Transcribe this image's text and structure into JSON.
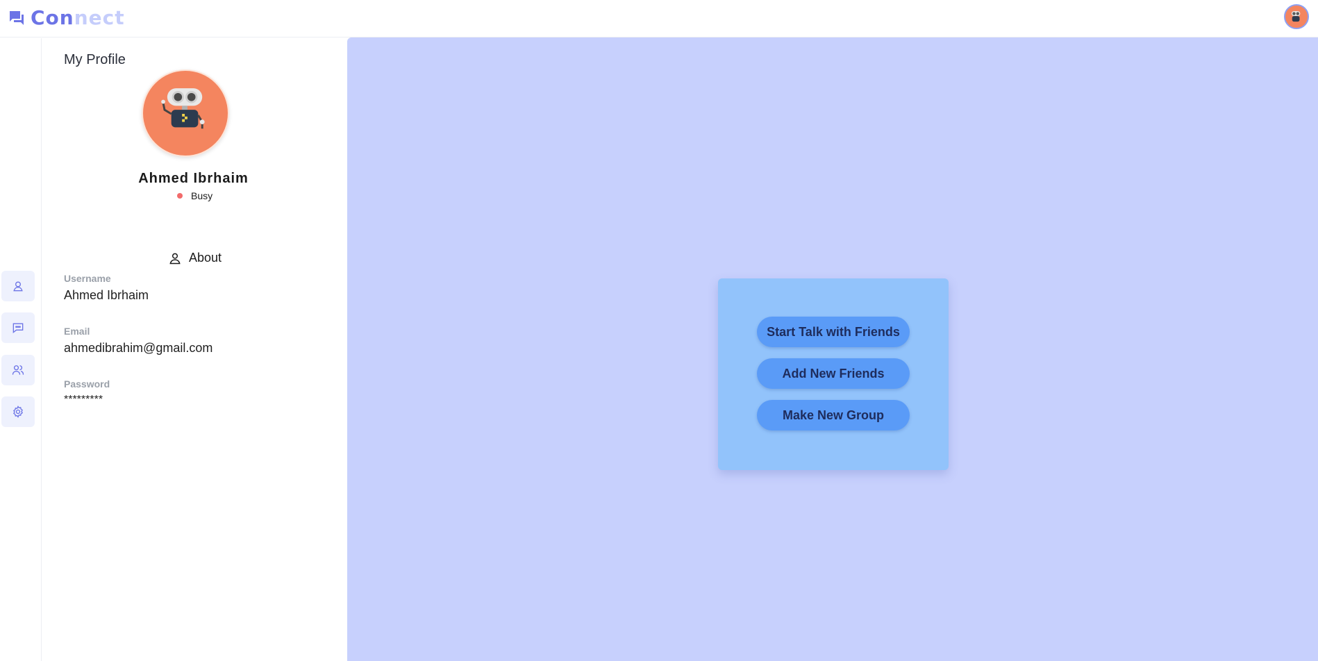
{
  "app": {
    "logo_part1": "Con",
    "logo_part2": "nect"
  },
  "rail": {
    "items": [
      {
        "name": "profile",
        "icon": "user-icon"
      },
      {
        "name": "chats",
        "icon": "chat-bubble-icon"
      },
      {
        "name": "friends",
        "icon": "users-icon"
      },
      {
        "name": "settings",
        "icon": "gear-icon"
      }
    ]
  },
  "profile": {
    "title": "My Profile",
    "name": "Ahmed Ibrhaim",
    "status": "Busy",
    "about_label": "About",
    "username_label": "Username",
    "username_value": "Ahmed Ibrhaim",
    "email_label": "Email",
    "email_value": "ahmedibrahim@gmail.com",
    "password_label": "Password",
    "password_value": "*********"
  },
  "actions": {
    "start_talk": "Start Talk with Friends",
    "add_friends": "Add New Friends",
    "new_group": "Make New Group"
  },
  "colors": {
    "brand": "#6c74e6",
    "brand_light": "#c5cdfb",
    "main_bg": "#c7d0fd",
    "card_bg": "#92c3fb",
    "button_bg": "#5a9bf7",
    "avatar_bg": "#f4855f",
    "status_busy": "#f26b6b"
  }
}
